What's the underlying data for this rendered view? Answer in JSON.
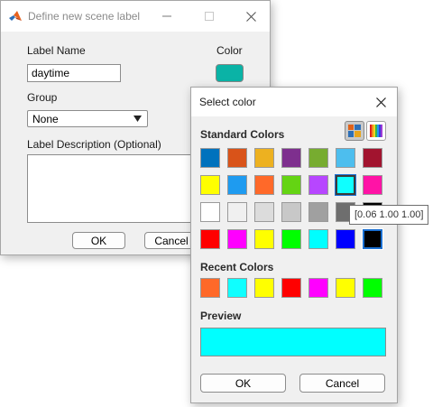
{
  "main_dialog": {
    "title": "Define new scene label",
    "label_name": {
      "label": "Label Name",
      "value": "daytime"
    },
    "color": {
      "label": "Color",
      "value": "#0ab3a6"
    },
    "group": {
      "label": "Group",
      "value": "None"
    },
    "description": {
      "label": "Label Description (Optional)",
      "value": ""
    },
    "ok_label": "OK",
    "cancel_label": "Cancel"
  },
  "color_dialog": {
    "title": "Select color",
    "standard_title": "Standard Colors",
    "standard_colors": [
      [
        "#0072bd",
        "#d95319",
        "#edb120",
        "#7e2f8e",
        "#77ac30",
        "#4dbeee",
        "#a2142f"
      ],
      [
        "#ffff00",
        "#1e9bf0",
        "#ff6929",
        "#64d413",
        "#b746ff",
        "#0fffff",
        "#ff13a6"
      ],
      [
        "#ffffff",
        "#f0f0f0",
        "#dcdcdc",
        "#c8c8c8",
        "#a0a0a0",
        "#6e6e6e",
        "#000000"
      ],
      [
        "#ff0000",
        "#ff00ff",
        "#ffff00",
        "#00ff00",
        "#00ffff",
        "#0000ff",
        "#000000"
      ]
    ],
    "selected_swatch": "row 2, column 6",
    "focused_swatch": "row 4, column 7",
    "recent_title": "Recent Colors",
    "recent_colors": [
      "#ff6929",
      "#0fffff",
      "#ffff00",
      "#ff0000",
      "#ff00ff",
      "#ffff00",
      "#00ff00"
    ],
    "preview_title": "Preview",
    "preview_color": "#00ffff",
    "ok_label": "OK",
    "cancel_label": "Cancel",
    "tooltip": "[0.06 1.00 1.00]"
  },
  "icons": {
    "app_logo": "matlab-logo-icon",
    "minimize": "minimize-icon",
    "maximize": "maximize-icon",
    "close": "close-icon",
    "standard_palette_mode": "palette-grid-icon",
    "custom_color_mode": "color-spectrum-icon",
    "dropdown": "caret-down-icon"
  }
}
